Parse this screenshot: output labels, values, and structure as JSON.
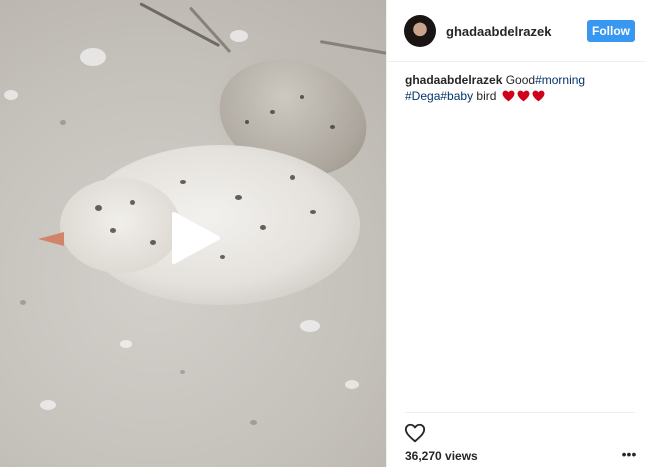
{
  "post": {
    "username": "ghadaabdelrazek",
    "follow_label": "Follow",
    "caption": {
      "username": "ghadaabdelrazek",
      "text_1": "Good",
      "hashtag_1": "#morning",
      "hashtag_2": "#Dega",
      "hashtag_3": "#baby",
      "text_2": " bird "
    },
    "views_label": "36,270 views",
    "more_label": "•••"
  },
  "icons": {
    "play": "play-icon",
    "like": "heart-outline-icon",
    "emoji_heart": "red-heart-emoji",
    "more": "more-options-icon"
  },
  "colors": {
    "follow_bg": "#3897f0",
    "hashtag": "#003569",
    "heart_emoji": "#d0021b"
  }
}
